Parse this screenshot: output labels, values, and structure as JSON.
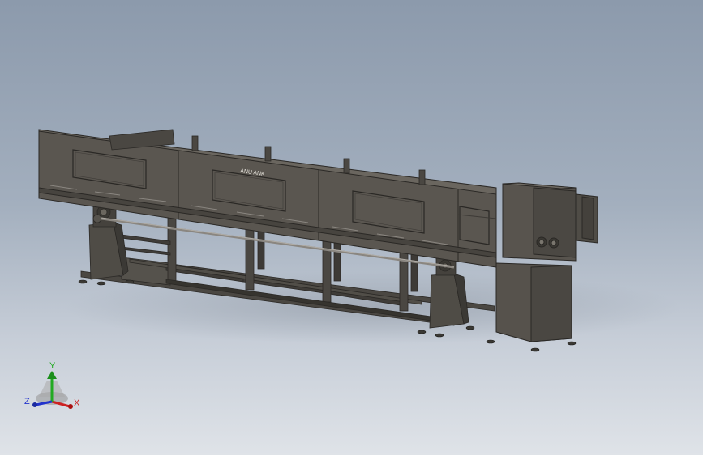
{
  "viewport": {
    "background_top": "#8c9aac",
    "background_bottom": "#dfe3e8"
  },
  "model": {
    "nameplate_text": "ANU ANK",
    "body_color": "#5a5650",
    "body_dark": "#3d3a36",
    "frame_color": "#4a4742",
    "rod_color": "#8a8680"
  },
  "triad": {
    "x_label": "X",
    "y_label": "Y",
    "z_label": "Z",
    "x_color": "#cc2222",
    "y_color": "#22aa22",
    "z_color": "#2233cc"
  }
}
